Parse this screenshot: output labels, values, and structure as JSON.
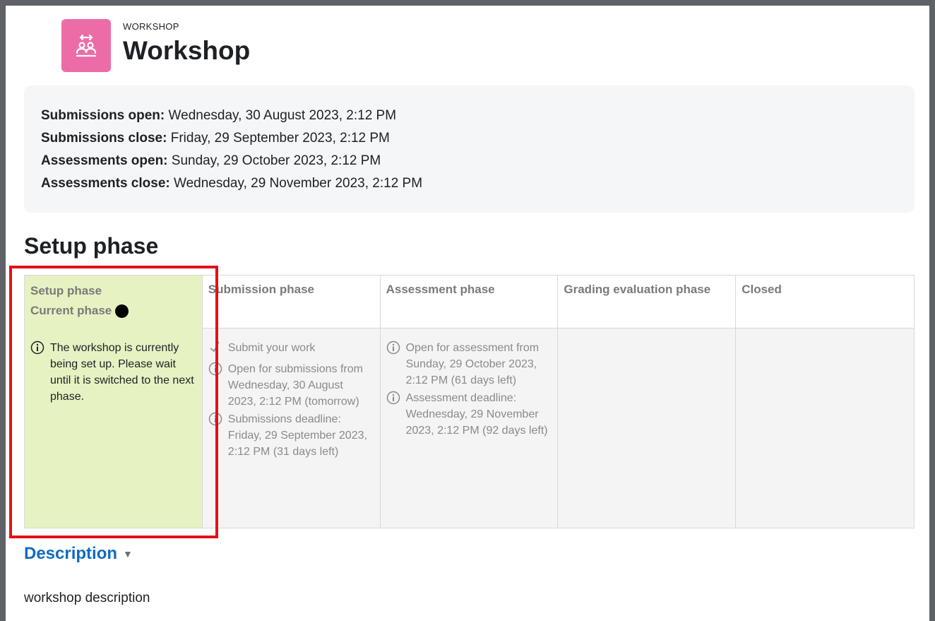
{
  "header": {
    "module_type": "WORKSHOP",
    "title": "Workshop",
    "icon": "workshop-icon",
    "icon_color": "#ec6ca8"
  },
  "dates": [
    {
      "label": "Submissions open:",
      "value": "Wednesday, 30 August 2023, 2:12 PM"
    },
    {
      "label": "Submissions close:",
      "value": "Friday, 29 September 2023, 2:12 PM"
    },
    {
      "label": "Assessments open:",
      "value": "Sunday, 29 October 2023, 2:12 PM"
    },
    {
      "label": "Assessments close:",
      "value": "Wednesday, 29 November 2023, 2:12 PM"
    }
  ],
  "phase_heading": "Setup phase",
  "phases": {
    "setup": {
      "title": "Setup phase",
      "current_label": "Current phase",
      "tasks": [
        {
          "icon": "info-icon",
          "text": "The workshop is currently being set up. Please wait until it is switched to the next phase."
        }
      ]
    },
    "submission": {
      "title": "Submission phase",
      "tasks": [
        {
          "icon": "todo-icon",
          "text": "Submit your work"
        },
        {
          "icon": "info-icon",
          "text": "Open for submissions from Wednesday, 30 August 2023, 2:12 PM (tomorrow)"
        },
        {
          "icon": "info-icon",
          "text": "Submissions deadline: Friday, 29 September 2023, 2:12 PM (31 days left)"
        }
      ]
    },
    "assessment": {
      "title": "Assessment phase",
      "tasks": [
        {
          "icon": "info-icon",
          "text": "Open for assessment from Sunday, 29 October 2023, 2:12 PM (61 days left)"
        },
        {
          "icon": "info-icon",
          "text": "Assessment deadline: Wednesday, 29 November 2023, 2:12 PM (92 days left)"
        }
      ]
    },
    "grading": {
      "title": "Grading evaluation phase"
    },
    "closed": {
      "title": "Closed"
    }
  },
  "description": {
    "toggle_label": "Description",
    "text": "workshop description"
  },
  "colors": {
    "active_phase_bg": "#e6f2c2",
    "highlight": "#e3111a",
    "link": "#0f6cbf"
  }
}
